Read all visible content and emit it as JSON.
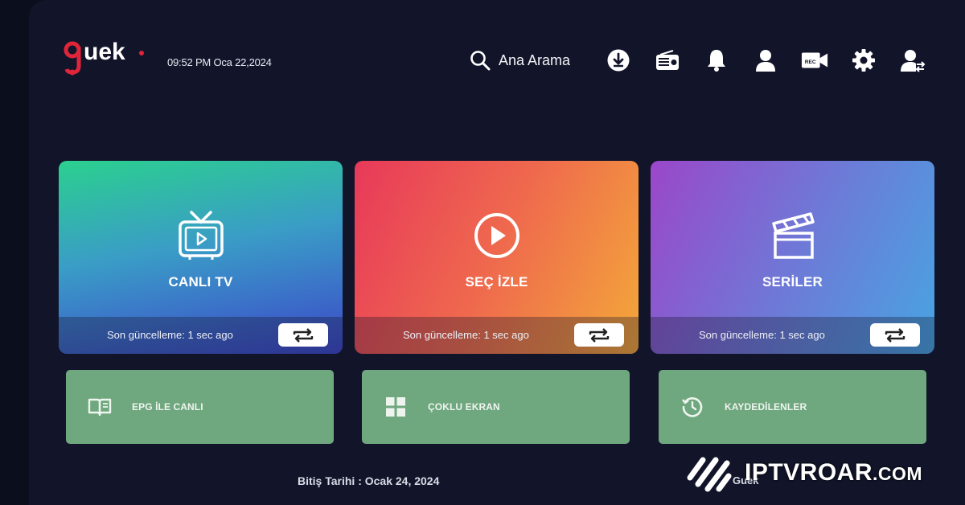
{
  "header": {
    "logo_text": "guek",
    "datetime": "09:52 PM  Oca 22,2024",
    "search_label": "Ana Arama",
    "icons": [
      "download-icon",
      "radio-icon",
      "bell-icon",
      "user-icon",
      "video-camera-icon",
      "gear-icon",
      "switch-user-icon"
    ]
  },
  "cards": [
    {
      "title": "CANLI TV",
      "update_text": "Son güncelleme: 1 sec ago",
      "icon": "tv-icon"
    },
    {
      "title": "SEÇ İZLE",
      "update_text": "Son güncelleme: 1 sec ago",
      "icon": "play-icon"
    },
    {
      "title": "SERİLER",
      "update_text": "Son güncelleme: 1 sec ago",
      "icon": "clapperboard-icon"
    }
  ],
  "buttons": [
    {
      "label": "EPG İLE CANLI",
      "icon": "book-icon"
    },
    {
      "label": "ÇOKLU EKRAN",
      "icon": "grid-icon"
    },
    {
      "label": "KAYDEDİLENLER",
      "icon": "history-icon"
    }
  ],
  "footer": {
    "expiry": "Bitiş Tarihi : Ocak 24, 2024",
    "brand": "Guek"
  },
  "watermark": {
    "name": "IPTVROAR",
    "suffix": ".COM"
  },
  "colors": {
    "background": "#12152a",
    "button_green": "#6fa77e",
    "logo_red": "#e0253a"
  }
}
